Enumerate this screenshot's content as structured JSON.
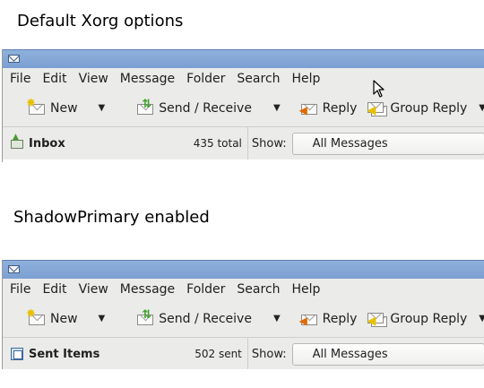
{
  "headings": {
    "first": "Default Xorg options",
    "second": "ShadowPrimary enabled"
  },
  "screenshots": [
    {
      "menu": [
        "File",
        "Edit",
        "View",
        "Message",
        "Folder",
        "Search",
        "Help"
      ],
      "toolbar": {
        "new": "New",
        "send_receive": "Send / Receive",
        "reply": "Reply",
        "group_reply": "Group Reply"
      },
      "folder": {
        "name": "Inbox",
        "count": "435 total"
      },
      "show_label": "Show:",
      "filter_value": "All Messages"
    },
    {
      "menu": [
        "File",
        "Edit",
        "View",
        "Message",
        "Folder",
        "Search",
        "Help"
      ],
      "toolbar": {
        "new": "New",
        "send_receive": "Send / Receive",
        "reply": "Reply",
        "group_reply": "Group Reply"
      },
      "folder": {
        "name": "Sent Items",
        "count": "502 sent"
      },
      "show_label": "Show:",
      "filter_value": "All Messages"
    }
  ],
  "icons": {
    "window": "envelope-icon",
    "new": "new-message-icon",
    "send_receive": "send-receive-icon",
    "reply": "reply-icon",
    "group_reply": "group-reply-icon",
    "dropdown": "dropdown-arrow-icon",
    "inbox": "inbox-icon",
    "sent": "sent-items-icon",
    "cursor": "mouse-pointer-icon"
  },
  "colors": {
    "titlebar": "#7b9fd2",
    "chrome": "#ebebe9"
  }
}
